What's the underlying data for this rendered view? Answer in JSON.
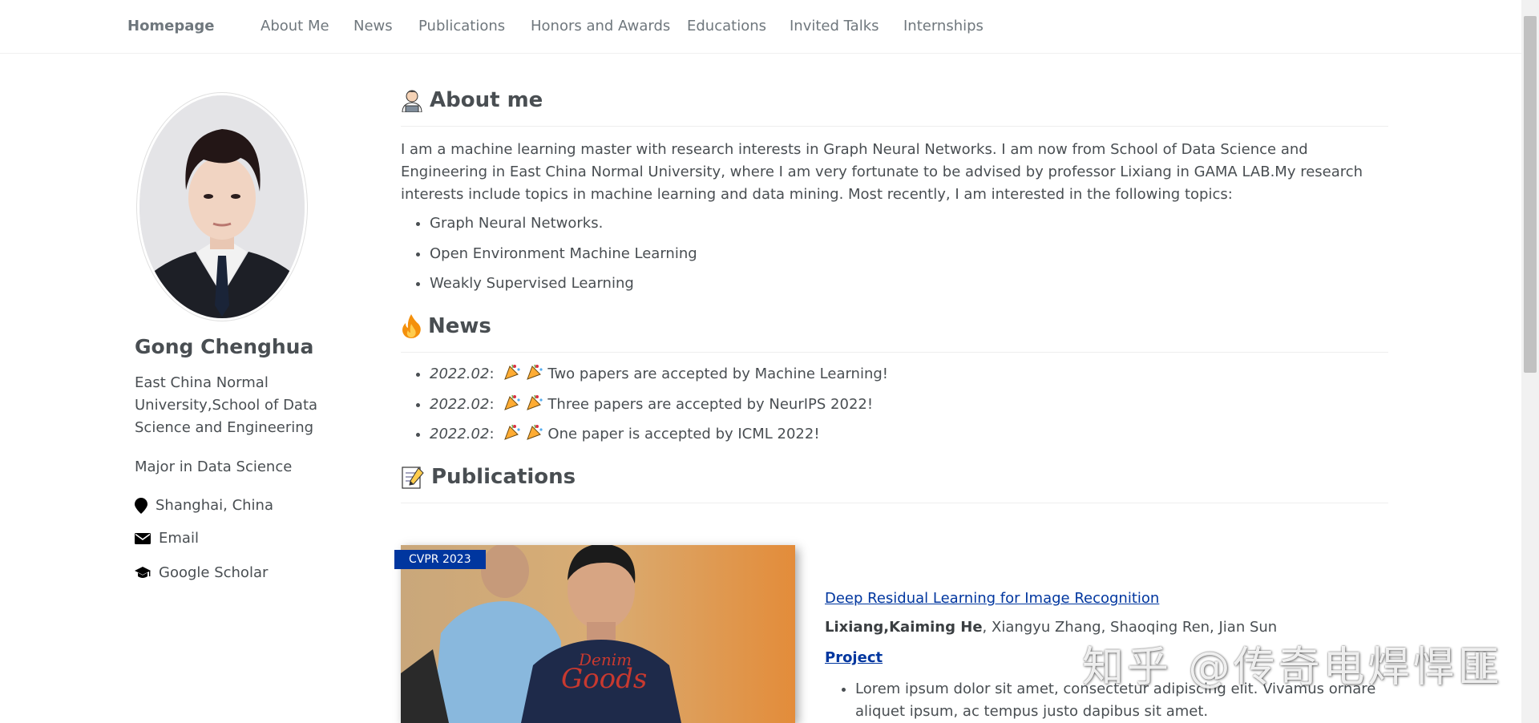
{
  "nav": {
    "home": "Homepage",
    "items": [
      "About Me",
      "News",
      "Publications",
      "Honors and Awards",
      "Educations",
      "Invited Talks",
      "Internships"
    ]
  },
  "sidebar": {
    "name": "Gong Chenghua",
    "bio": "East China Normal University,School of Data Science and Engineering",
    "major": "Major in Data Science",
    "location": "Shanghai, China",
    "email": "Email",
    "scholar": "Google Scholar"
  },
  "about": {
    "title": "About me",
    "paragraph": "I am a machine learning master with research interests in Graph Neural Networks. I am now from School of Data Science and Engineering in East China Normal University, where I am very fortunate to be advised by professor Lixiang in GAMA LAB.My research interests include topics in machine learning and data mining. Most recently, I am interested in the following topics:",
    "topics": [
      "Graph Neural Networks.",
      "Open Environment Machine Learning",
      "Weakly Supervised Learning"
    ]
  },
  "news": {
    "title": "News",
    "items": [
      {
        "date": "2022.02",
        "text": "Two papers are accepted by Machine Learning!"
      },
      {
        "date": "2022.02",
        "text": "Three papers are accepted by NeurIPS 2022!"
      },
      {
        "date": "2022.02",
        "text": "One paper is accepted by ICML 2022!"
      }
    ]
  },
  "publications": {
    "title": "Publications",
    "items": [
      {
        "badge": "CVPR 2023",
        "title": "Deep Residual Learning for Image Recognition",
        "authors_bold": "Lixiang,Kaiming He",
        "authors_rest": ", Xiangyu Zhang, Shaoqing Ren, Jian Sun",
        "project": "Project",
        "desc": "Lorem ipsum dolor sit amet, consectetur adipiscing elit. Vivamus ornare aliquet ipsum, ac tempus justo dapibus sit amet."
      }
    ]
  },
  "watermark": "知乎 @传奇电焊悍匪",
  "colors": {
    "link": "#00369f",
    "text": "#494e52",
    "nav": "#6f777d",
    "badge": "#00369f"
  }
}
